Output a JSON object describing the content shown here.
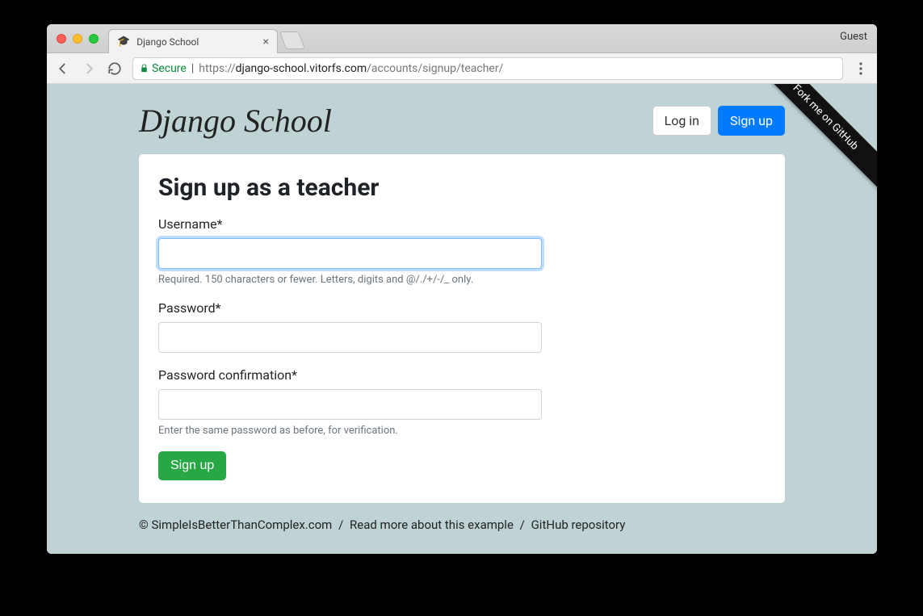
{
  "browser": {
    "tab_title": "Django School",
    "guest_label": "Guest",
    "secure_label": "Secure",
    "url_scheme": "https://",
    "url_host": "django-school.vitorfs.com",
    "url_path": "/accounts/signup/teacher/"
  },
  "page": {
    "brand": "Django School",
    "login_label": "Log in",
    "signup_label": "Sign up",
    "ribbon": "Fork me on GitHub",
    "heading": "Sign up as a teacher",
    "form": {
      "username_label": "Username*",
      "username_value": "",
      "username_help": "Required. 150 characters or fewer. Letters, digits and @/./+/-/_ only.",
      "password_label": "Password*",
      "password_value": "",
      "password2_label": "Password confirmation*",
      "password2_value": "",
      "password2_help": "Enter the same password as before, for verification.",
      "submit_label": "Sign up"
    },
    "footer": {
      "copyright": "© SimpleIsBetterThanComplex.com",
      "link1": "Read more about this example",
      "link2": "GitHub repository"
    }
  }
}
